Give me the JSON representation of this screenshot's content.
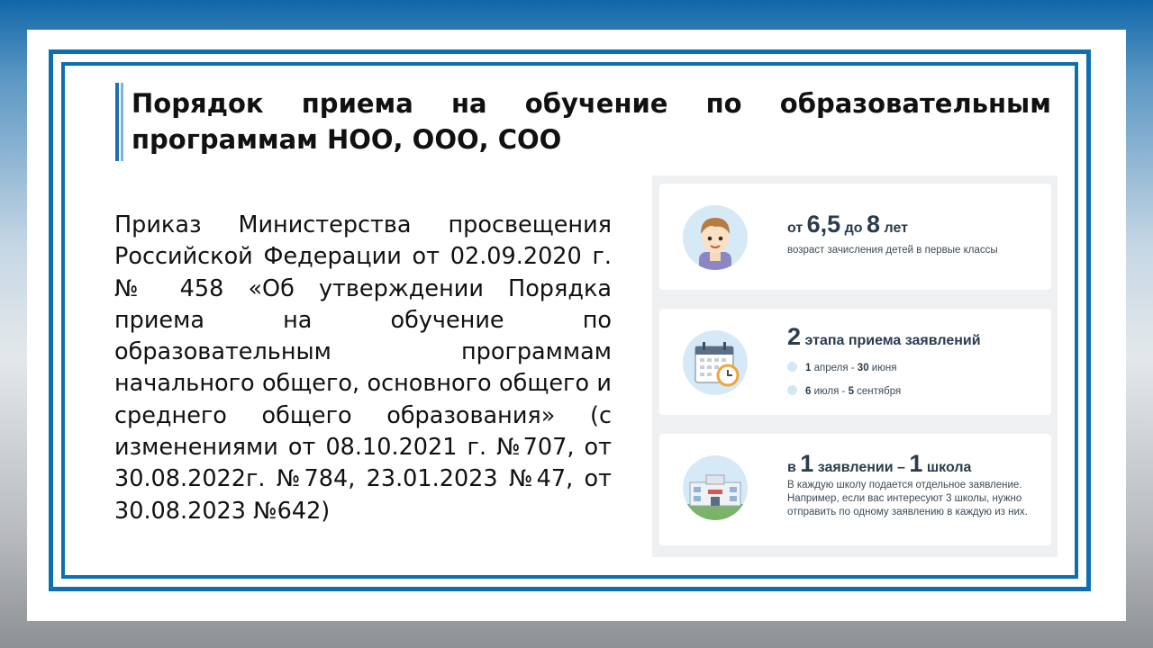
{
  "title": "Порядок приема на обучение по образовательным программам  НОО, ООО, СОО",
  "body_text": "Приказ Министерства просвещения Российской Федерации от 02.09.2020 г. № 458 «Об утверждении Порядка приема на обучение по образовательным программам начального общего, основного общего и среднего общего образования»  (с изменениями от 08.10.2021 г. №707, от 30.08.2022г. №784, 23.01.2023 №47, от 30.08.2023 №642)",
  "card_age": {
    "pre": "от ",
    "num1": "6,5",
    "mid": " до ",
    "num2": "8",
    "post": " лет",
    "caption": "возраст зачисления детей в первые классы"
  },
  "card_stages": {
    "num": "2",
    "heading": " этапа приема заявлений",
    "stage1_num": "1",
    "stage1_text": " апреля - ",
    "stage1_num2": "30",
    "stage1_text2": " июня",
    "stage2_num": "6",
    "stage2_text": " июля - ",
    "stage2_num2": "5",
    "stage2_text2": " сентября"
  },
  "card_school": {
    "pre": "в ",
    "num1": "1",
    "mid": " заявлении – ",
    "num2": "1",
    "post": " школа",
    "caption": "В каждую школу подается отдельное заявление. Например, если вас интересуют 3 школы, нужно отправить по одному заявлению в каждую из них."
  },
  "colors": {
    "frame": "#0f6fae",
    "accent_dark": "#2a3c4d",
    "avatar_bg": "#d6e9f7"
  },
  "icons": [
    "child-icon",
    "calendar-icon",
    "school-icon"
  ]
}
